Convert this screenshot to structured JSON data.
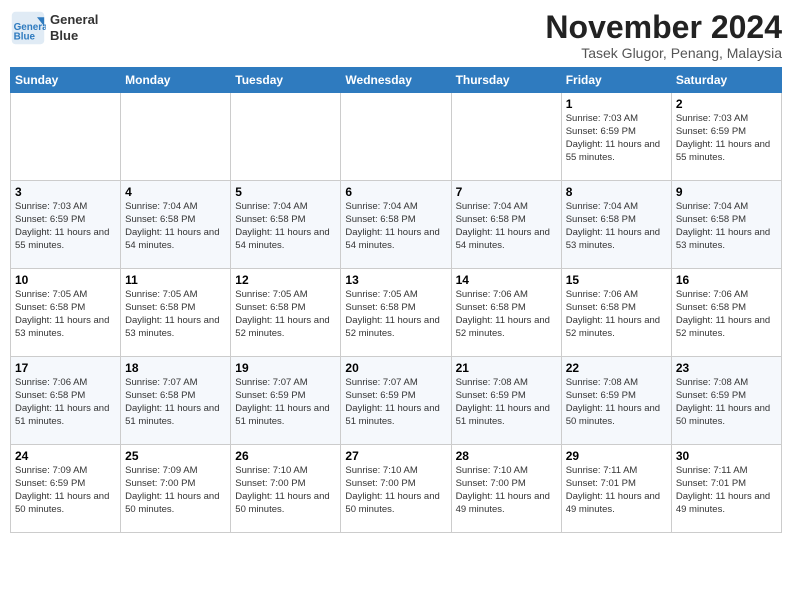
{
  "header": {
    "logo_line1": "General",
    "logo_line2": "Blue",
    "month_title": "November 2024",
    "location": "Tasek Glugor, Penang, Malaysia"
  },
  "weekdays": [
    "Sunday",
    "Monday",
    "Tuesday",
    "Wednesday",
    "Thursday",
    "Friday",
    "Saturday"
  ],
  "weeks": [
    [
      {
        "day": "",
        "info": ""
      },
      {
        "day": "",
        "info": ""
      },
      {
        "day": "",
        "info": ""
      },
      {
        "day": "",
        "info": ""
      },
      {
        "day": "",
        "info": ""
      },
      {
        "day": "1",
        "info": "Sunrise: 7:03 AM\nSunset: 6:59 PM\nDaylight: 11 hours and 55 minutes."
      },
      {
        "day": "2",
        "info": "Sunrise: 7:03 AM\nSunset: 6:59 PM\nDaylight: 11 hours and 55 minutes."
      }
    ],
    [
      {
        "day": "3",
        "info": "Sunrise: 7:03 AM\nSunset: 6:59 PM\nDaylight: 11 hours and 55 minutes."
      },
      {
        "day": "4",
        "info": "Sunrise: 7:04 AM\nSunset: 6:58 PM\nDaylight: 11 hours and 54 minutes."
      },
      {
        "day": "5",
        "info": "Sunrise: 7:04 AM\nSunset: 6:58 PM\nDaylight: 11 hours and 54 minutes."
      },
      {
        "day": "6",
        "info": "Sunrise: 7:04 AM\nSunset: 6:58 PM\nDaylight: 11 hours and 54 minutes."
      },
      {
        "day": "7",
        "info": "Sunrise: 7:04 AM\nSunset: 6:58 PM\nDaylight: 11 hours and 54 minutes."
      },
      {
        "day": "8",
        "info": "Sunrise: 7:04 AM\nSunset: 6:58 PM\nDaylight: 11 hours and 53 minutes."
      },
      {
        "day": "9",
        "info": "Sunrise: 7:04 AM\nSunset: 6:58 PM\nDaylight: 11 hours and 53 minutes."
      }
    ],
    [
      {
        "day": "10",
        "info": "Sunrise: 7:05 AM\nSunset: 6:58 PM\nDaylight: 11 hours and 53 minutes."
      },
      {
        "day": "11",
        "info": "Sunrise: 7:05 AM\nSunset: 6:58 PM\nDaylight: 11 hours and 53 minutes."
      },
      {
        "day": "12",
        "info": "Sunrise: 7:05 AM\nSunset: 6:58 PM\nDaylight: 11 hours and 52 minutes."
      },
      {
        "day": "13",
        "info": "Sunrise: 7:05 AM\nSunset: 6:58 PM\nDaylight: 11 hours and 52 minutes."
      },
      {
        "day": "14",
        "info": "Sunrise: 7:06 AM\nSunset: 6:58 PM\nDaylight: 11 hours and 52 minutes."
      },
      {
        "day": "15",
        "info": "Sunrise: 7:06 AM\nSunset: 6:58 PM\nDaylight: 11 hours and 52 minutes."
      },
      {
        "day": "16",
        "info": "Sunrise: 7:06 AM\nSunset: 6:58 PM\nDaylight: 11 hours and 52 minutes."
      }
    ],
    [
      {
        "day": "17",
        "info": "Sunrise: 7:06 AM\nSunset: 6:58 PM\nDaylight: 11 hours and 51 minutes."
      },
      {
        "day": "18",
        "info": "Sunrise: 7:07 AM\nSunset: 6:58 PM\nDaylight: 11 hours and 51 minutes."
      },
      {
        "day": "19",
        "info": "Sunrise: 7:07 AM\nSunset: 6:59 PM\nDaylight: 11 hours and 51 minutes."
      },
      {
        "day": "20",
        "info": "Sunrise: 7:07 AM\nSunset: 6:59 PM\nDaylight: 11 hours and 51 minutes."
      },
      {
        "day": "21",
        "info": "Sunrise: 7:08 AM\nSunset: 6:59 PM\nDaylight: 11 hours and 51 minutes."
      },
      {
        "day": "22",
        "info": "Sunrise: 7:08 AM\nSunset: 6:59 PM\nDaylight: 11 hours and 50 minutes."
      },
      {
        "day": "23",
        "info": "Sunrise: 7:08 AM\nSunset: 6:59 PM\nDaylight: 11 hours and 50 minutes."
      }
    ],
    [
      {
        "day": "24",
        "info": "Sunrise: 7:09 AM\nSunset: 6:59 PM\nDaylight: 11 hours and 50 minutes."
      },
      {
        "day": "25",
        "info": "Sunrise: 7:09 AM\nSunset: 7:00 PM\nDaylight: 11 hours and 50 minutes."
      },
      {
        "day": "26",
        "info": "Sunrise: 7:10 AM\nSunset: 7:00 PM\nDaylight: 11 hours and 50 minutes."
      },
      {
        "day": "27",
        "info": "Sunrise: 7:10 AM\nSunset: 7:00 PM\nDaylight: 11 hours and 50 minutes."
      },
      {
        "day": "28",
        "info": "Sunrise: 7:10 AM\nSunset: 7:00 PM\nDaylight: 11 hours and 49 minutes."
      },
      {
        "day": "29",
        "info": "Sunrise: 7:11 AM\nSunset: 7:01 PM\nDaylight: 11 hours and 49 minutes."
      },
      {
        "day": "30",
        "info": "Sunrise: 7:11 AM\nSunset: 7:01 PM\nDaylight: 11 hours and 49 minutes."
      }
    ]
  ]
}
